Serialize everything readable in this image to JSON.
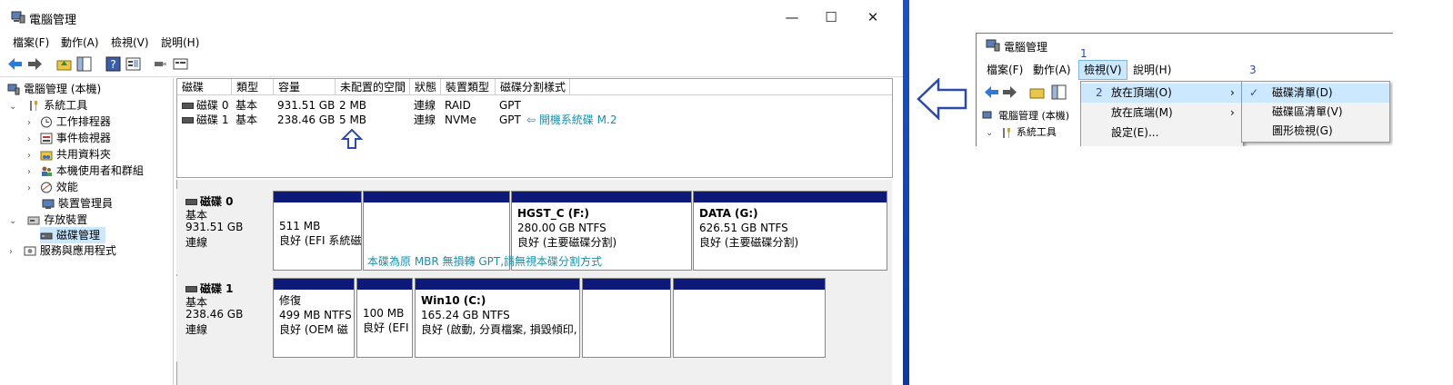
{
  "main": {
    "title": "電腦管理",
    "controls": {
      "minimize": "—",
      "maximize": "☐",
      "close": "✕"
    },
    "menu": [
      "檔案(F)",
      "動作(A)",
      "檢視(V)",
      "說明(H)"
    ],
    "tree": {
      "root": "電腦管理 (本機)",
      "system_tools": "系統工具",
      "task_scheduler": "工作排程器",
      "event_viewer": "事件檢視器",
      "shared_folders": "共用資料夾",
      "local_users": "本機使用者和群組",
      "performance": "效能",
      "device_manager": "裝置管理員",
      "storage": "存放裝置",
      "disk_management": "磁碟管理",
      "services": "服務與應用程式"
    },
    "list": {
      "headers": [
        "磁碟",
        "類型",
        "容量",
        "未配置的空間",
        "狀態",
        "裝置類型",
        "磁碟分割樣式"
      ],
      "rows": [
        [
          "磁碟 0",
          "基本",
          "931.51 GB",
          "2 MB",
          "連線",
          "RAID",
          "GPT"
        ],
        [
          "磁碟 1",
          "基本",
          "238.46 GB",
          "5 MB",
          "連線",
          "NVMe",
          "GPT"
        ]
      ],
      "annotation": "⇦ 開機系統碟 M.2"
    },
    "disk0": {
      "name": "磁碟 0",
      "type": "基本",
      "size": "931.51 GB",
      "status": "連線",
      "partitions": [
        {
          "line1": "",
          "line2": "511 MB",
          "line3": "良好 (EFI 系統磁"
        },
        {
          "line1": "",
          "line2": "",
          "line3": ""
        },
        {
          "line1": "HGST_C  (F:)",
          "line2": "280.00 GB NTFS",
          "line3": "良好 (主要磁碟分割)"
        },
        {
          "line1": "DATA  (G:)",
          "line2": "626.51 GB NTFS",
          "line3": "良好 (主要磁碟分割)"
        }
      ],
      "note": "本碟為原 MBR 無損轉 GPT,請無視本碟分割方式"
    },
    "disk1": {
      "name": "磁碟 1",
      "type": "基本",
      "size": "238.46 GB",
      "status": "連線",
      "partitions": [
        {
          "line1": "修復",
          "line2": "499 MB NTFS",
          "line3": "良好 (OEM 磁"
        },
        {
          "line1": "",
          "line2": "100 MB",
          "line3": "良好 (EFI 系"
        },
        {
          "line1": "Win10  (C:)",
          "line2": "165.24 GB NTFS",
          "line3": "良好 (啟動, 分頁檔案, 損毀傾印,"
        },
        {
          "line1": "",
          "line2": "",
          "line3": ""
        },
        {
          "line1": "",
          "line2": "",
          "line3": ""
        }
      ]
    }
  },
  "inset": {
    "title": "電腦管理",
    "step1": "1",
    "step2": "2",
    "step3": "3",
    "menu": [
      "檔案(F)",
      "動作(A)",
      "檢視(V)",
      "說明(H)"
    ],
    "tree_root": "電腦管理 (本機)",
    "tree_sys": "系統工具",
    "view_menu": [
      "放在頂端(O)",
      "放在底端(M)",
      "設定(E)..."
    ],
    "submenu": [
      "磁碟清單(D)",
      "磁碟區清單(V)",
      "圖形檢視(G)"
    ],
    "submenu_check": "✓",
    "submenu_arrow": "›"
  },
  "colors": {
    "accent": "#1d8fa8",
    "partition_header": "#0e1a7a",
    "highlight": "#cce8ff"
  }
}
